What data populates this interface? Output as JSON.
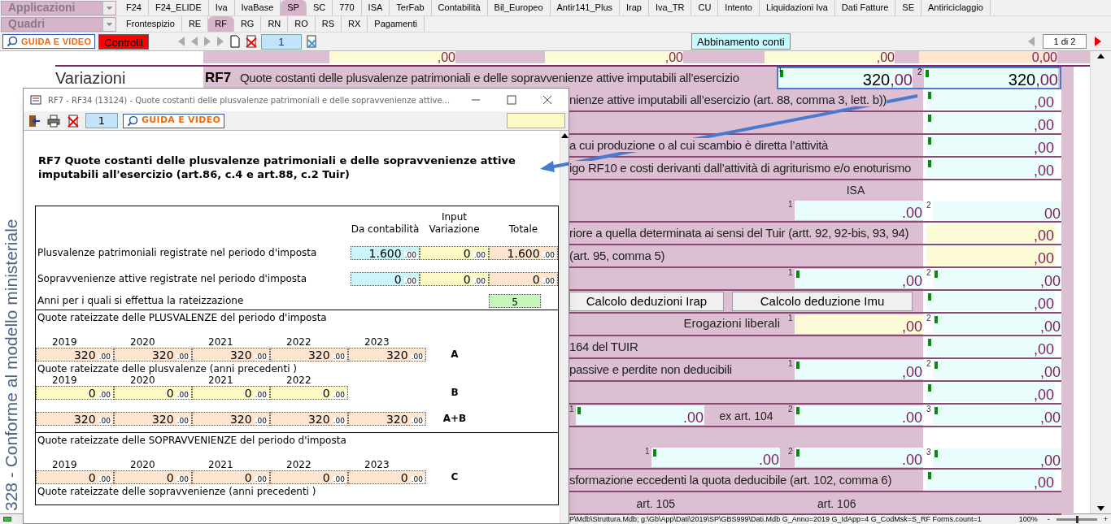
{
  "menu_rows": [
    {
      "dropdown": "Applicazioni",
      "tabs": [
        {
          "label": "F24",
          "selected": false
        },
        {
          "label": "F24_ELIDE",
          "selected": false
        },
        {
          "label": "Iva",
          "selected": false
        },
        {
          "label": "IvaBase",
          "selected": false
        },
        {
          "label": "SP",
          "selected": true
        },
        {
          "label": "SC",
          "selected": false
        },
        {
          "label": "770",
          "selected": false
        },
        {
          "label": "ISA",
          "selected": false
        },
        {
          "label": "TerFab",
          "selected": false
        },
        {
          "label": "Contabilità",
          "selected": false
        },
        {
          "label": "Bil_Europeo",
          "selected": false
        },
        {
          "label": "Antir141_Plus",
          "selected": false
        },
        {
          "label": "Irap",
          "selected": false
        },
        {
          "label": "Iva_TR",
          "selected": false
        },
        {
          "label": "CU",
          "selected": false
        },
        {
          "label": "Intento",
          "selected": false
        },
        {
          "label": "Liquidazioni Iva",
          "selected": false
        },
        {
          "label": "Dati Fatture",
          "selected": false
        },
        {
          "label": "SE",
          "selected": false
        },
        {
          "label": "Antiriciclaggio",
          "selected": false
        }
      ]
    },
    {
      "dropdown": "Quadri",
      "tabs": [
        {
          "label": "Frontespizio",
          "selected": false
        },
        {
          "label": "RE",
          "selected": false
        },
        {
          "label": "RF",
          "selected": true
        },
        {
          "label": "RG",
          "selected": false
        },
        {
          "label": "RN",
          "selected": false
        },
        {
          "label": "RO",
          "selected": false
        },
        {
          "label": "RS",
          "selected": false
        },
        {
          "label": "RX",
          "selected": false
        },
        {
          "label": "Pagamenti",
          "selected": false
        }
      ]
    }
  ],
  "toolbar": {
    "help_button": "GUIDA E VIDEO",
    "checks_button": "Controlli",
    "page_field": "1",
    "match_button": "Abbinamento conti",
    "pager": "1 di 2"
  },
  "side_caption": "328 - Conforme al modello ministeriale",
  "form": {
    "top_values": [
      ",00",
      ",00",
      ",00",
      "0,00"
    ],
    "section": "Variazioni",
    "row_code": "RF7",
    "row_label": "Quote costanti delle plusvalenze patrimoniali e delle sopravvenienze attive imputabili all’esercizio",
    "row_fields": [
      {
        "index": "1",
        "flagged": true,
        "value": "320",
        "decimals": ",00"
      },
      {
        "index": "2",
        "flagged": true,
        "value": "320",
        "decimals": ",00"
      }
    ],
    "rows": [
      {
        "tall": false,
        "items": [
          {
            "kind": "text",
            "text": "nienze attive imputabili all’esercizio (art. 88, comma 3, lett. b))"
          }
        ],
        "end": {
          "flagged": true,
          "input": false,
          "decimals": ",00"
        }
      },
      {
        "tall": false,
        "items": [],
        "end": {
          "flagged": true,
          "input": false,
          "decimals": ",00"
        }
      },
      {
        "tall": false,
        "items": [
          {
            "kind": "text",
            "text": "a cui produzione o al cui scambio è diretta l’attività"
          }
        ],
        "end": {
          "flagged": true,
          "input": false,
          "decimals": ",00"
        }
      },
      {
        "tall": false,
        "items": [
          {
            "kind": "text",
            "text": "igo RF10 e costi derivanti dall’attività di agriturismo e/o enoturismo"
          }
        ],
        "end": {
          "flagged": true,
          "input": false,
          "decimals": ",00"
        }
      },
      {
        "tall": true,
        "items": [
          {
            "kind": "field",
            "heading": "ISA",
            "index": "1",
            "flagged": false,
            "input": false,
            "decimals": ".00"
          }
        ],
        "end": {
          "index": "2",
          "flagged": false,
          "input": false,
          "decimals": "00"
        }
      },
      {
        "tall": false,
        "items": [
          {
            "kind": "text",
            "text": "riore a quella determinata ai sensi del Tuir (artt. 92, 92-bis, 93, 94)"
          }
        ],
        "end": {
          "flagged": false,
          "input": true,
          "decimals": ",00"
        }
      },
      {
        "tall": false,
        "items": [
          {
            "kind": "text",
            "text": "(art. 95, comma 5)"
          }
        ],
        "end": {
          "flagged": false,
          "input": true,
          "decimals": ",00"
        }
      },
      {
        "tall": false,
        "items": [
          {
            "kind": "field",
            "index": "1",
            "flagged": true,
            "input": false,
            "decimals": ",00"
          }
        ],
        "end": {
          "index": "2",
          "flagged": true,
          "input": false,
          "decimals": ",00"
        }
      },
      {
        "tall": false,
        "items": [
          {
            "kind": "button",
            "text": "Calcolo deduzioni Irap"
          },
          {
            "kind": "button",
            "text": "Calcolo deduzione Imu"
          }
        ],
        "end": {
          "flagged": true,
          "input": false,
          "decimals": ",00"
        }
      },
      {
        "tall": false,
        "items": [
          {
            "kind": "label",
            "text": "Erogazioni liberali"
          },
          {
            "kind": "field",
            "index": "1",
            "flagged": false,
            "input": true,
            "decimals": ",00"
          }
        ],
        "end": {
          "index": "2",
          "flagged": true,
          "input": false,
          "decimals": ",00"
        }
      },
      {
        "tall": false,
        "items": [
          {
            "kind": "text",
            "text": "164 del TUIR"
          }
        ],
        "end": {
          "flagged": true,
          "input": false,
          "decimals": ",00"
        }
      },
      {
        "tall": false,
        "items": [
          {
            "kind": "text",
            "text": "passive e perdite non deducibili"
          },
          {
            "kind": "field",
            "index": "1",
            "flagged": true,
            "input": false,
            "decimals": ",00"
          }
        ],
        "end": {
          "index": "2",
          "flagged": true,
          "input": false,
          "decimals": ",00"
        }
      },
      {
        "tall": false,
        "items": [],
        "end": {
          "flagged": true,
          "input": false,
          "decimals": ",00"
        }
      },
      {
        "tall": false,
        "items": [
          {
            "kind": "field",
            "index": "1",
            "flagged": true,
            "input": false,
            "decimals": ".00"
          },
          {
            "kind": "caption",
            "text": "ex art. 104"
          },
          {
            "kind": "field",
            "index": "2",
            "flagged": true,
            "input": false,
            "decimals": ".00"
          }
        ],
        "end": {
          "index": "3",
          "flagged": true,
          "input": false,
          "decimals": ",00"
        }
      },
      {
        "tall": true,
        "items": [
          {
            "kind": "field",
            "index": "1",
            "flagged": true,
            "input": false,
            "decimals": ".00"
          },
          {
            "kind": "field",
            "index": "2",
            "flagged": true,
            "input": false,
            "decimals": ".00"
          }
        ],
        "end": {
          "index": "3",
          "flagged": true,
          "input": false,
          "decimals": ",00"
        }
      },
      {
        "tall": false,
        "items": [
          {
            "kind": "text",
            "text": "sformazione eccedenti la quota deducibile (art. 102, comma 6)"
          }
        ],
        "end": {
          "flagged": true,
          "input": false,
          "decimals": ",00"
        }
      },
      {
        "tall": false,
        "items": [
          {
            "kind": "caption",
            "text": "art. 105"
          },
          {
            "kind": "caption",
            "text": "art. 106"
          }
        ]
      }
    ]
  },
  "dialog": {
    "title": "RF7 - RF34 (13124) - Quote costanti delle plusvalenze patrimoniali e delle sopravvenienze attive...",
    "page_field": "1",
    "help_button": "GUIDA E VIDEO",
    "heading": "RF7 Quote costanti delle plusvalenze patrimoniali e delle sopravvenienze attive imputabili all'esercizio (art.86, c.4 e art.88, c.2 Tuir)",
    "columns": [
      "Da contabilità",
      "Input Variazione",
      "Totale"
    ],
    "rows": [
      {
        "label": "Plusvalenze patrimoniali registrate nel periodo d'imposta",
        "cells": [
          {
            "kind": "account",
            "value": "1.600",
            "decimals": ".00"
          },
          {
            "kind": "input",
            "value": "0",
            "decimals": ".00"
          },
          {
            "kind": "computed",
            "value": "1.600",
            "decimals": ".00"
          }
        ]
      },
      {
        "label": "Sopravvenienze attive registrate nel periodo d'imposta",
        "cells": [
          {
            "kind": "account",
            "value": "0",
            "decimals": ".00"
          },
          {
            "kind": "input",
            "value": "0",
            "decimals": ".00"
          },
          {
            "kind": "computed",
            "value": "0",
            "decimals": ".00"
          }
        ]
      }
    ],
    "years_label": "Anni per i quali si effettua la rateizzazione",
    "years_value": "5",
    "sections": [
      {
        "groups": [
          {
            "title": "Quote rateizzate delle PLUSVALENZE del periodo d'imposta",
            "years": [
              "2019",
              "2020",
              "2021",
              "2022",
              "2023"
            ],
            "letter": "A",
            "cells": [
              {
                "kind": "computed",
                "value": "320",
                "decimals": ".00"
              },
              {
                "kind": "computed",
                "value": "320",
                "decimals": ".00"
              },
              {
                "kind": "computed",
                "value": "320",
                "decimals": ".00"
              },
              {
                "kind": "computed",
                "value": "320",
                "decimals": ".00"
              },
              {
                "kind": "computed",
                "value": "320",
                "decimals": ".00"
              }
            ]
          },
          {
            "title": "Quote rateizzate delle plusvalenze  (anni precedenti )",
            "years": [
              "2019",
              "2020",
              "2021",
              "2022"
            ],
            "letter": "B",
            "cells": [
              {
                "kind": "input",
                "value": "0",
                "decimals": ".00"
              },
              {
                "kind": "input",
                "value": "0",
                "decimals": ".00"
              },
              {
                "kind": "input",
                "value": "0",
                "decimals": ".00"
              },
              {
                "kind": "input",
                "value": "0",
                "decimals": ".00"
              }
            ]
          },
          {
            "letter": "A+B",
            "cells": [
              {
                "kind": "computed",
                "value": "320",
                "decimals": ".00"
              },
              {
                "kind": "computed",
                "value": "320",
                "decimals": ".00"
              },
              {
                "kind": "computed",
                "value": "320",
                "decimals": ".00"
              },
              {
                "kind": "computed",
                "value": "320",
                "decimals": ".00"
              },
              {
                "kind": "computed",
                "value": "320",
                "decimals": ".00"
              }
            ]
          }
        ]
      },
      {
        "groups": [
          {
            "title": "Quote rateizzate delle SOPRAVVENIENZE del periodo d'imposta",
            "years": [
              "2019",
              "2020",
              "2021",
              "2022",
              "2023"
            ],
            "letter": "C",
            "cells": [
              {
                "kind": "computed",
                "value": "0",
                "decimals": ".00"
              },
              {
                "kind": "computed",
                "value": "0",
                "decimals": ".00"
              },
              {
                "kind": "computed",
                "value": "0",
                "decimals": ".00"
              },
              {
                "kind": "computed",
                "value": "0",
                "decimals": ".00"
              },
              {
                "kind": "computed",
                "value": "0",
                "decimals": ".00"
              }
            ]
          },
          {
            "title": "Quote rateizzate delle sopravvenienze  (anni precedenti )"
          }
        ]
      }
    ]
  },
  "status_bar": {
    "zoom_slider": {
      "level": 0.5
    },
    "path": "P\\Mdb\\Struttura.Mdb; g:\\Gb\\App\\Dati\\2019\\SP\\GBS999\\Dati.Mdb G_Anno=2019 G_IdApp=4 G_CodMsk=S_RF Forms.count=1",
    "zoom": "100%",
    "zoom_out": "-",
    "zoom_in": "+"
  }
}
